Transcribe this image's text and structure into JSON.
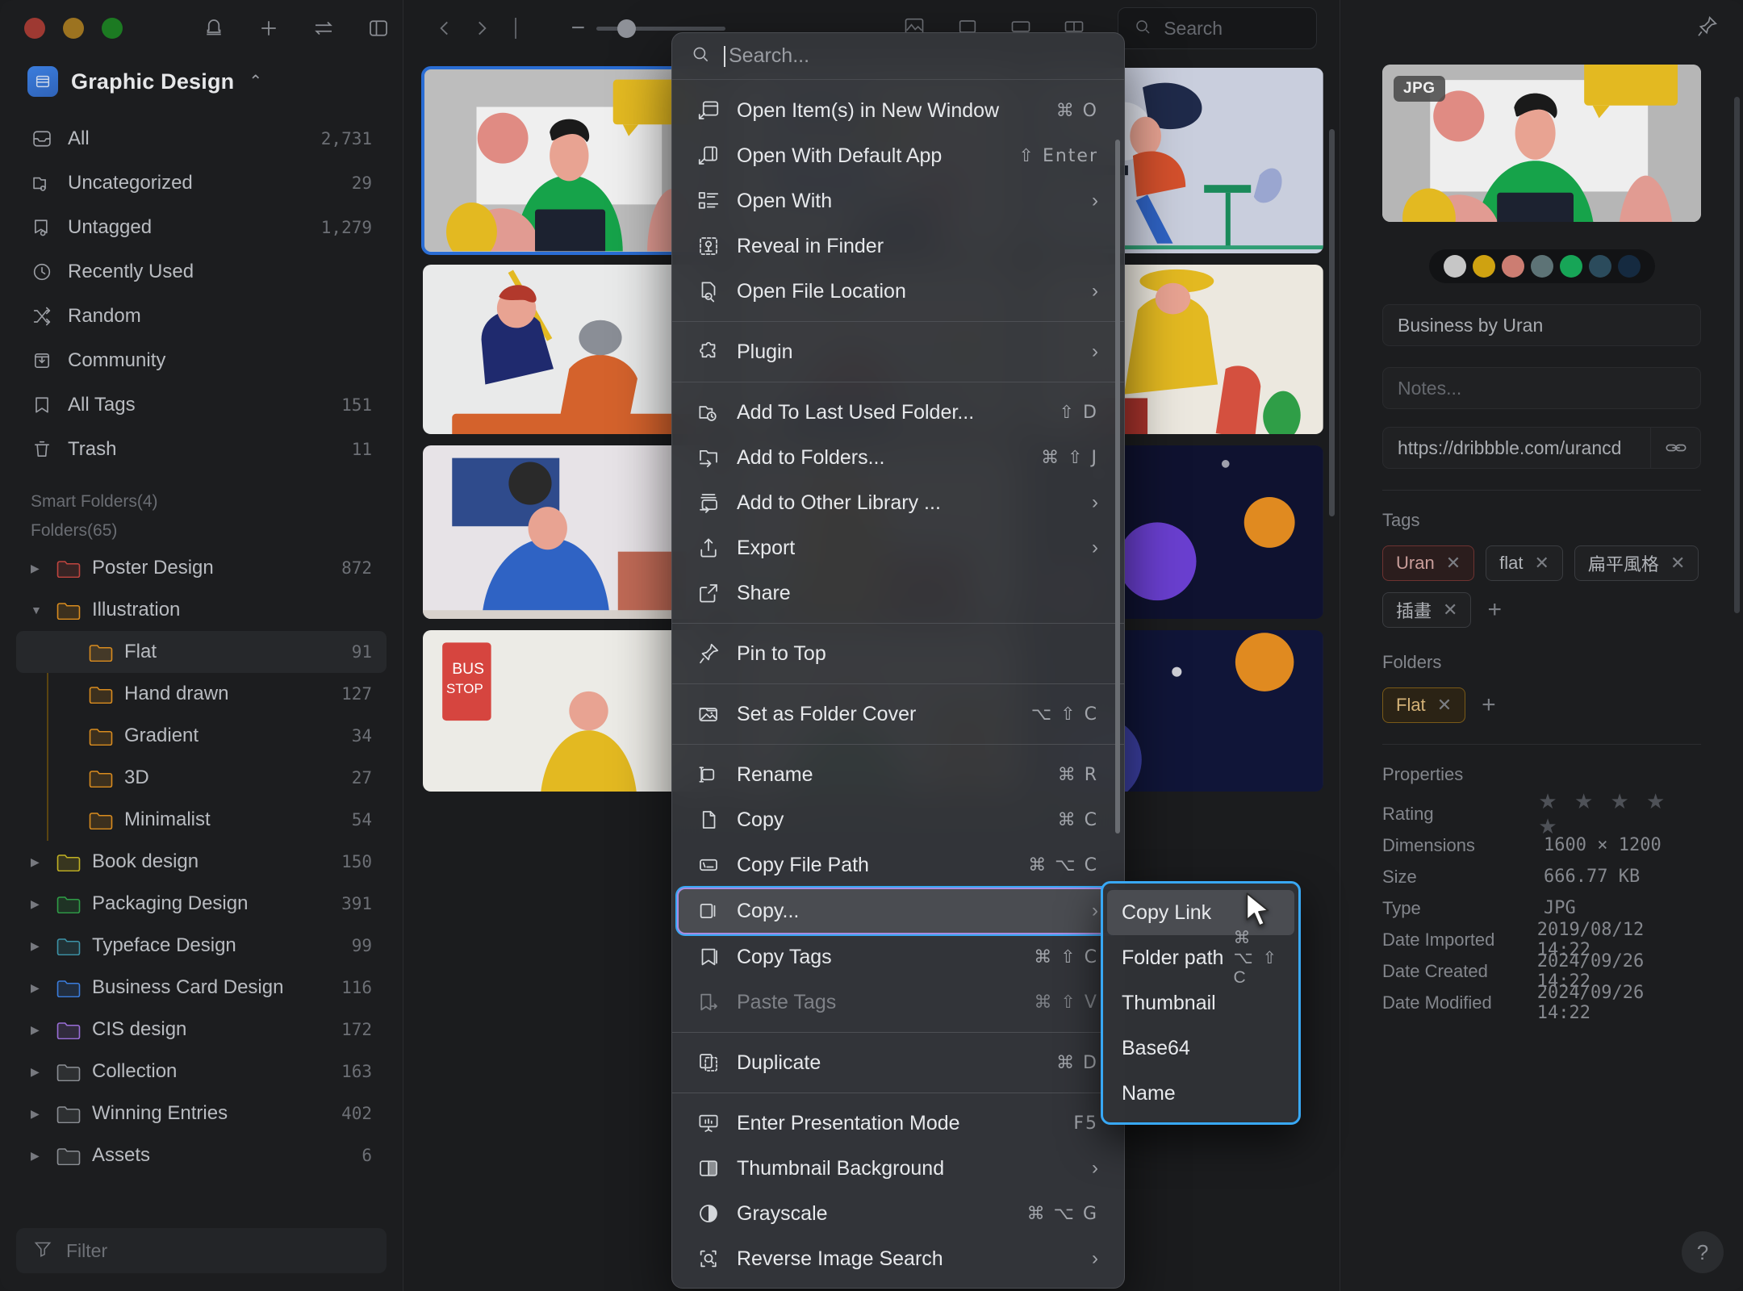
{
  "window": {
    "traffic_lights": [
      "close",
      "minimize",
      "zoom"
    ],
    "pin_icon": "pin-icon"
  },
  "sidebar": {
    "toolbar_icons": [
      "bell-icon",
      "plus-icon",
      "transfer-icon",
      "panel-toggle-icon"
    ],
    "library": {
      "name": "Graphic Design",
      "chevron": "⌃⌄"
    },
    "nav": [
      {
        "label": "All",
        "count": "2,731",
        "icon": "inbox-icon"
      },
      {
        "label": "Uncategorized",
        "count": "29",
        "icon": "folder-question-icon"
      },
      {
        "label": "Untagged",
        "count": "1,279",
        "icon": "tag-question-icon"
      },
      {
        "label": "Recently Used",
        "count": "",
        "icon": "clock-icon"
      },
      {
        "label": "Random",
        "count": "",
        "icon": "shuffle-icon"
      },
      {
        "label": "Community",
        "count": "",
        "icon": "community-icon"
      },
      {
        "label": "All Tags",
        "count": "151",
        "icon": "bookmark-icon"
      },
      {
        "label": "Trash",
        "count": "11",
        "icon": "trash-icon"
      }
    ],
    "smart_folders_label": "Smart Folders(4)",
    "folders_label": "Folders(65)",
    "folders": [
      {
        "label": "Poster Design",
        "count": "872",
        "color": "#c0453f",
        "depth": 0,
        "expanded": false,
        "selected": false
      },
      {
        "label": "Illustration",
        "count": "",
        "color": "#d98c1f",
        "depth": 0,
        "expanded": true,
        "selected": false
      },
      {
        "label": "Flat",
        "count": "91",
        "color": "#d98c1f",
        "depth": 1,
        "expanded": null,
        "selected": true
      },
      {
        "label": "Hand drawn",
        "count": "127",
        "color": "#d98c1f",
        "depth": 1,
        "expanded": null,
        "selected": false
      },
      {
        "label": "Gradient",
        "count": "34",
        "color": "#d98c1f",
        "depth": 1,
        "expanded": null,
        "selected": false
      },
      {
        "label": "3D",
        "count": "27",
        "color": "#d98c1f",
        "depth": 1,
        "expanded": null,
        "selected": false
      },
      {
        "label": "Minimalist",
        "count": "54",
        "color": "#d98c1f",
        "depth": 1,
        "expanded": null,
        "selected": false
      },
      {
        "label": "Book design",
        "count": "150",
        "color": "#c2b223",
        "depth": 0,
        "expanded": false,
        "selected": false
      },
      {
        "label": "Packaging Design",
        "count": "391",
        "color": "#2f9e47",
        "depth": 0,
        "expanded": false,
        "selected": false
      },
      {
        "label": "Typeface Design",
        "count": "99",
        "color": "#3d93a8",
        "depth": 0,
        "expanded": false,
        "selected": false
      },
      {
        "label": "Business Card Design",
        "count": "116",
        "color": "#3b7ddd",
        "depth": 0,
        "expanded": false,
        "selected": false
      },
      {
        "label": "CIS design",
        "count": "172",
        "color": "#9a6ed8",
        "depth": 0,
        "expanded": false,
        "selected": false
      },
      {
        "label": "Collection",
        "count": "163",
        "color": "#8b8e94",
        "depth": 0,
        "expanded": false,
        "selected": false
      },
      {
        "label": "Winning Entries",
        "count": "402",
        "color": "#8b8e94",
        "depth": 0,
        "expanded": false,
        "selected": false
      },
      {
        "label": "Assets",
        "count": "6",
        "color": "#8b8e94",
        "depth": 0,
        "expanded": false,
        "selected": false
      }
    ],
    "filter": {
      "placeholder": "Filter",
      "icon": "funnel-icon"
    }
  },
  "center": {
    "nav_back": "chevron-left-icon",
    "nav_forward": "chevron-right-icon",
    "zoom": {
      "minus": "−",
      "value": 18
    },
    "view_icons": [
      "grid-view-icon",
      "list-view-icon",
      "wide-view-icon",
      "columns-view-icon"
    ],
    "search": {
      "placeholder": "Search",
      "icon": "search-icon"
    }
  },
  "context_menu": {
    "search": {
      "placeholder": "Search...",
      "icon": "search-icon"
    },
    "groups": [
      [
        {
          "label": "Open Item(s) in New Window",
          "shortcut": "⌘ O",
          "icon": "open-new-window-icon",
          "submenu": false,
          "disabled": false
        },
        {
          "label": "Open With Default App",
          "shortcut": "⇧ Enter",
          "icon": "open-default-app-icon",
          "submenu": false,
          "disabled": false
        },
        {
          "label": "Open With",
          "shortcut": "",
          "icon": "app-list-icon",
          "submenu": true,
          "disabled": false
        },
        {
          "label": "Reveal in Finder",
          "shortcut": "",
          "icon": "finder-icon",
          "submenu": false,
          "disabled": false
        },
        {
          "label": "Open File Location",
          "shortcut": "",
          "icon": "file-search-icon",
          "submenu": true,
          "disabled": false
        }
      ],
      [
        {
          "label": "Plugin",
          "shortcut": "",
          "icon": "plugin-icon",
          "submenu": true,
          "disabled": false
        }
      ],
      [
        {
          "label": "Add To Last Used Folder...",
          "shortcut": "⇧ D",
          "icon": "folder-clock-icon",
          "submenu": false,
          "disabled": false
        },
        {
          "label": "Add to Folders...",
          "shortcut": "⌘ ⇧ J",
          "icon": "folder-add-icon",
          "submenu": false,
          "disabled": false
        },
        {
          "label": "Add to Other Library ...",
          "shortcut": "",
          "icon": "library-add-icon",
          "submenu": true,
          "disabled": false
        },
        {
          "label": "Export",
          "shortcut": "",
          "icon": "export-icon",
          "submenu": true,
          "disabled": false
        },
        {
          "label": "Share",
          "shortcut": "",
          "icon": "share-icon",
          "submenu": false,
          "disabled": false
        }
      ],
      [
        {
          "label": "Pin to Top",
          "shortcut": "",
          "icon": "pin-icon",
          "submenu": false,
          "disabled": false
        }
      ],
      [
        {
          "label": "Set as Folder Cover",
          "shortcut": "⌥ ⇧ C",
          "icon": "image-cover-icon",
          "submenu": false,
          "disabled": false
        }
      ],
      [
        {
          "label": "Rename",
          "shortcut": "⌘ R",
          "icon": "rename-icon",
          "submenu": false,
          "disabled": false
        },
        {
          "label": "Copy",
          "shortcut": "⌘ C",
          "icon": "copy-icon",
          "submenu": false,
          "disabled": false
        },
        {
          "label": "Copy File Path",
          "shortcut": "⌘ ⌥ C",
          "icon": "copy-path-icon",
          "submenu": false,
          "disabled": false
        },
        {
          "label": "Copy...",
          "shortcut": "",
          "icon": "copy-as-icon",
          "submenu": true,
          "disabled": false,
          "highlighted": true
        },
        {
          "label": "Copy Tags",
          "shortcut": "⌘ ⇧ C",
          "icon": "copy-tags-icon",
          "submenu": false,
          "disabled": false
        },
        {
          "label": "Paste Tags",
          "shortcut": "⌘ ⇧ V",
          "icon": "paste-tags-icon",
          "submenu": false,
          "disabled": true
        }
      ],
      [
        {
          "label": "Duplicate",
          "shortcut": "⌘ D",
          "icon": "duplicate-icon",
          "submenu": false,
          "disabled": false
        }
      ],
      [
        {
          "label": "Enter Presentation Mode",
          "shortcut": "F5",
          "icon": "presentation-icon",
          "submenu": false,
          "disabled": false
        },
        {
          "label": "Thumbnail Background",
          "shortcut": "",
          "icon": "thumbnail-bg-icon",
          "submenu": true,
          "disabled": false
        },
        {
          "label": "Grayscale",
          "shortcut": "⌘ ⌥ G",
          "icon": "grayscale-icon",
          "submenu": false,
          "disabled": false
        },
        {
          "label": "Reverse Image Search",
          "shortcut": "",
          "icon": "reverse-search-icon",
          "submenu": true,
          "disabled": false
        }
      ]
    ]
  },
  "submenu": {
    "items": [
      {
        "label": "Copy Link",
        "shortcut": "",
        "highlighted": true
      },
      {
        "label": "Folder path",
        "shortcut": "⌘ ⌥ ⇧ C",
        "highlighted": false
      },
      {
        "label": "Thumbnail",
        "shortcut": "",
        "highlighted": false
      },
      {
        "label": "Base64",
        "shortcut": "",
        "highlighted": false
      },
      {
        "label": "Name",
        "shortcut": "",
        "highlighted": false
      }
    ]
  },
  "inspector": {
    "badge": "JPG",
    "swatches": [
      "#c6c6c6",
      "#cfa211",
      "#cc7d72",
      "#5d7376",
      "#17a557",
      "#2b4b5c",
      "#152a40"
    ],
    "title": {
      "value": "Business by Uran"
    },
    "notes": {
      "placeholder": "Notes..."
    },
    "url": {
      "value": "https://dribbble.com/urancd",
      "icon": "link-icon"
    },
    "tags_label": "Tags",
    "tags": [
      {
        "label": "Uran",
        "color": "red"
      },
      {
        "label": "flat",
        "color": "default"
      },
      {
        "label": "扁平風格",
        "color": "default"
      },
      {
        "label": "插畫",
        "color": "default"
      }
    ],
    "tags_add": "+",
    "folders_label": "Folders",
    "folders": [
      {
        "label": "Flat",
        "color": "orange"
      }
    ],
    "folders_add": "+",
    "properties_label": "Properties",
    "properties": [
      {
        "key": "Rating",
        "value": "★ ★ ★ ★ ★",
        "is_stars": true
      },
      {
        "key": "Dimensions",
        "value": "1600 × 1200",
        "is_stars": false
      },
      {
        "key": "Size",
        "value": "666.77 KB",
        "is_stars": false
      },
      {
        "key": "Type",
        "value": "JPG",
        "is_stars": false
      },
      {
        "key": "Date Imported",
        "value": "2019/08/12 14:22",
        "is_stars": false
      },
      {
        "key": "Date Created",
        "value": "2024/09/26 14:22",
        "is_stars": false
      },
      {
        "key": "Date Modified",
        "value": "2024/09/26 14:22",
        "is_stars": false
      }
    ],
    "help": "?"
  }
}
